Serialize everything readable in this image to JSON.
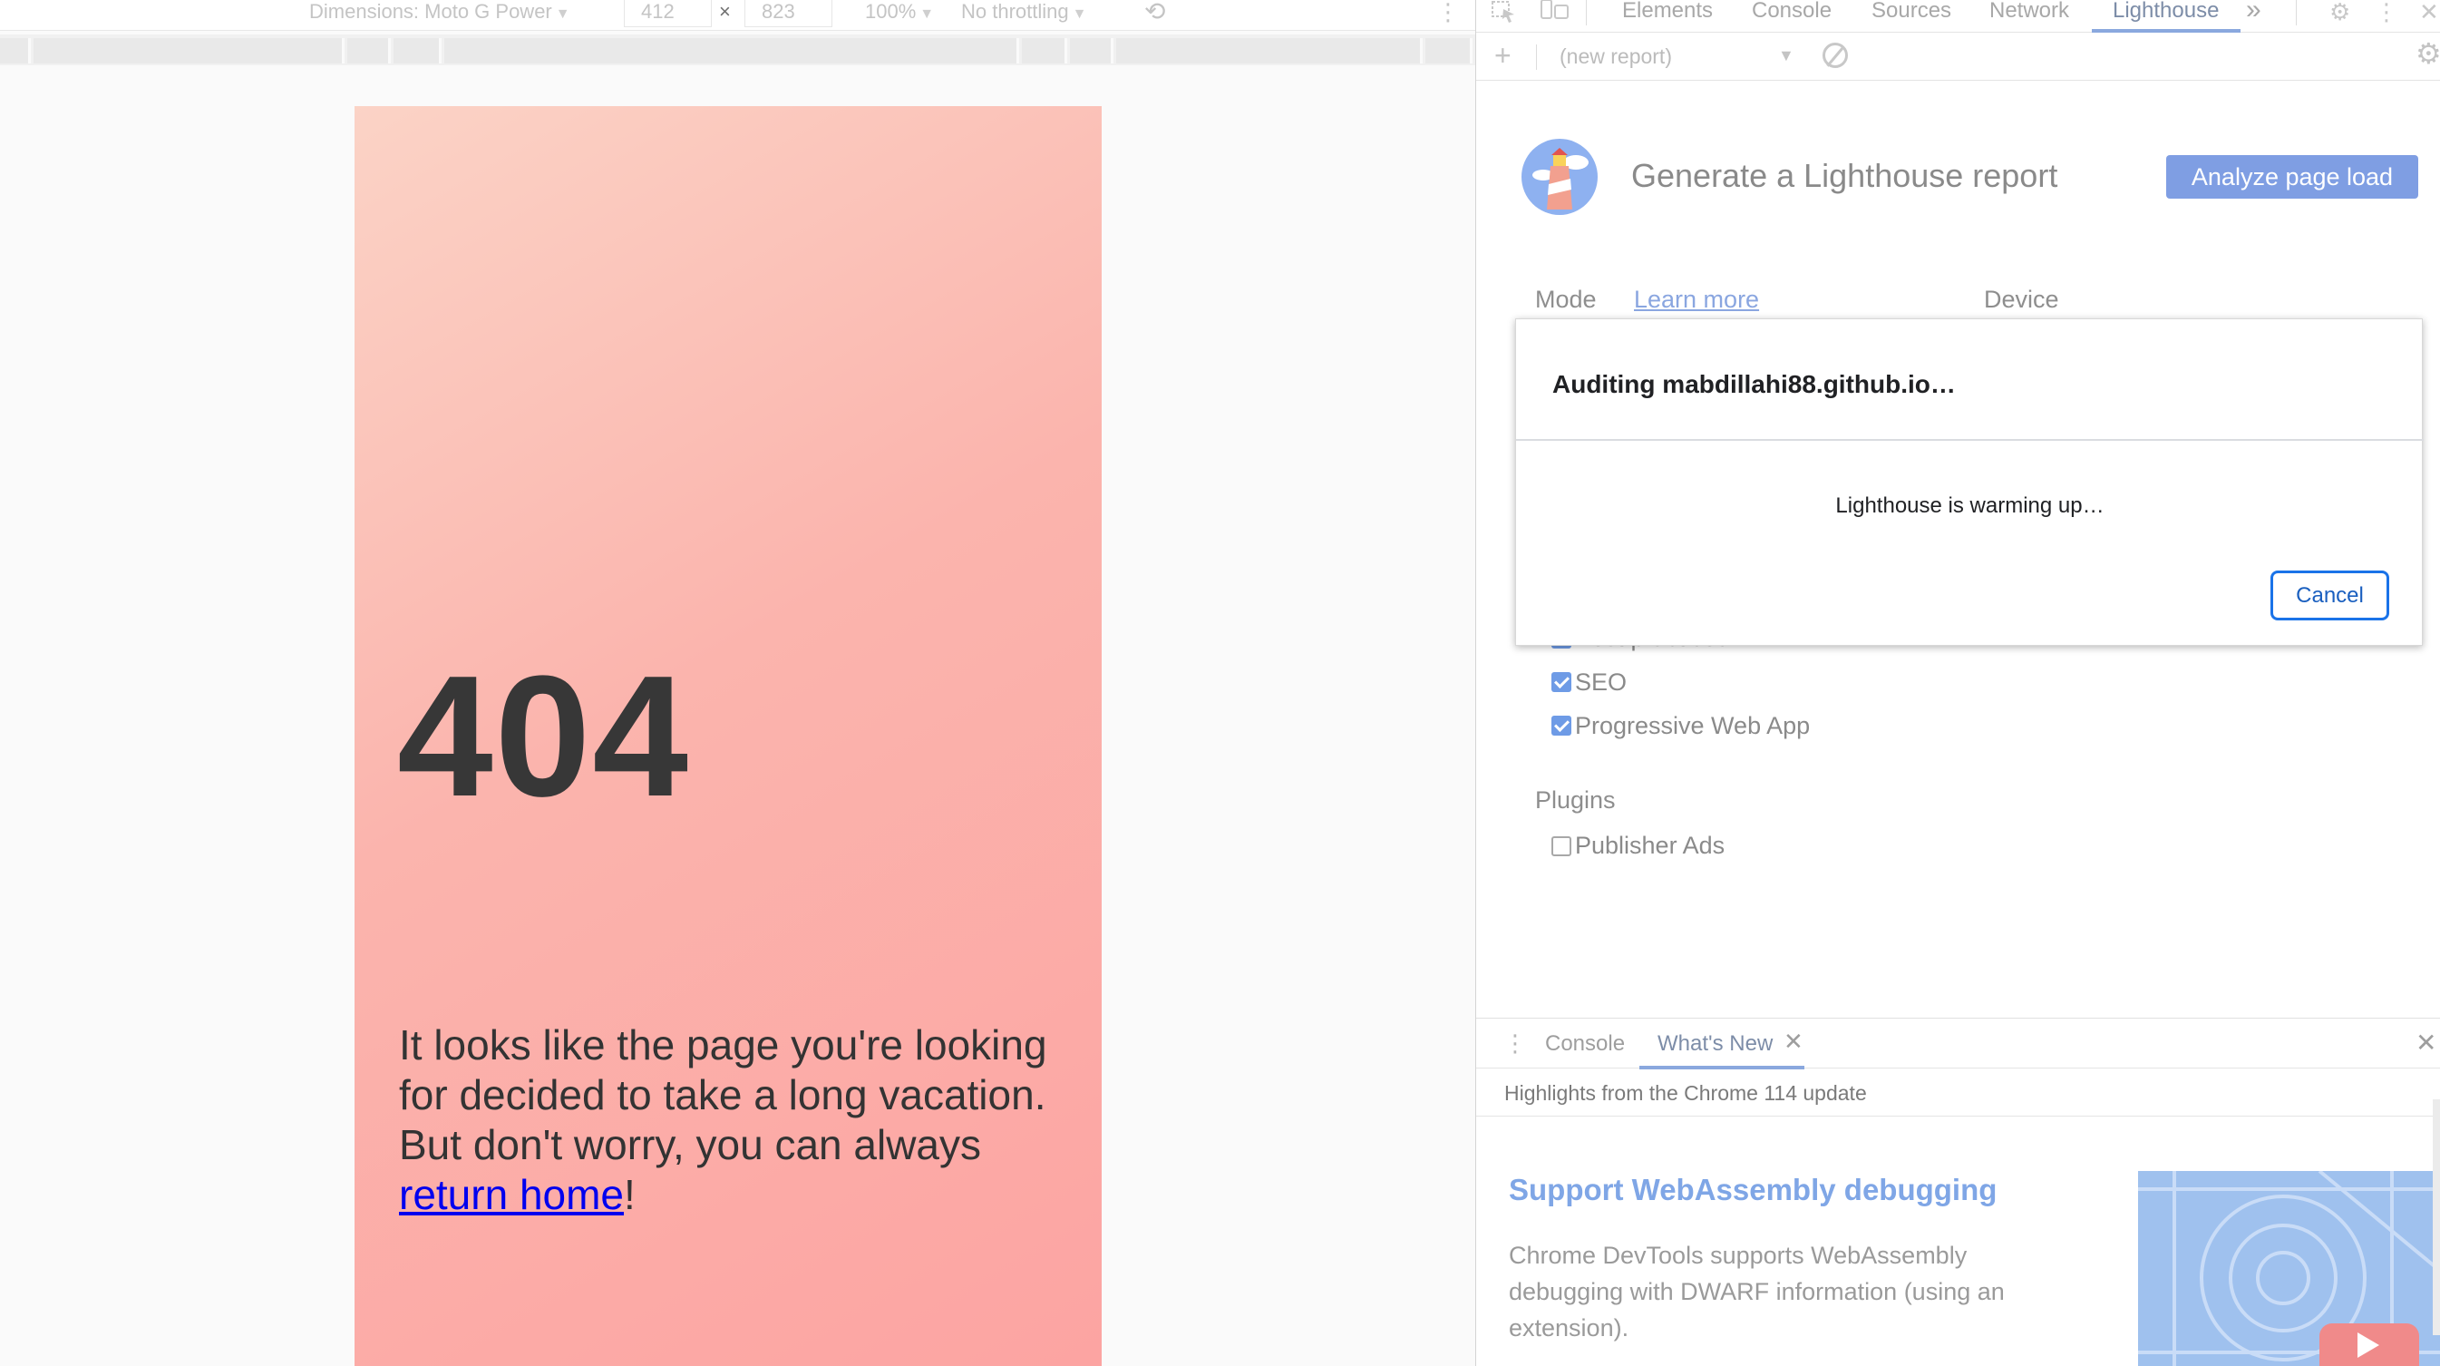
{
  "device_toolbar": {
    "dimensions_label": "Dimensions: Moto G Power",
    "width": "412",
    "times": "×",
    "height": "823",
    "zoom": "100%",
    "throttling": "No throttling"
  },
  "page": {
    "error_code": "404",
    "message_before_link": "It looks like the page you're looking for decided to take a long vacation. But don't worry, you can always ",
    "link_text": "return home",
    "message_after_link": "!"
  },
  "devtools": {
    "tabs": [
      "Elements",
      "Console",
      "Sources",
      "Network",
      "Lighthouse"
    ],
    "active_tab": "Lighthouse",
    "more_tabs": "»",
    "report_select": "(new report)",
    "lighthouse": {
      "title": "Generate a Lighthouse report",
      "analyze_button": "Analyze page load",
      "mode_label": "Mode",
      "learn_more": "Learn more",
      "device_label": "Device",
      "categories": [
        {
          "label": "Best practices",
          "checked": true
        },
        {
          "label": "SEO",
          "checked": true
        },
        {
          "label": "Progressive Web App",
          "checked": true
        }
      ],
      "plugins_label": "Plugins",
      "plugins": [
        {
          "label": "Publisher Ads",
          "checked": false
        }
      ]
    },
    "dialog": {
      "title": "Auditing mabdillahi88.github.io…",
      "status": "Lighthouse is warming up…",
      "cancel": "Cancel"
    },
    "drawer": {
      "tabs": [
        "Console",
        "What's New"
      ],
      "active_tab": "What's New",
      "highlights": "Highlights from the Chrome 114 update",
      "feature_title": "Support WebAssembly debugging",
      "feature_desc": "Chrome DevTools supports WebAssembly debugging with DWARF information (using an extension)."
    }
  },
  "colors": {
    "accent": "#1a73e8",
    "analyze_button": "#7f9ee3",
    "page_gradient_start": "#fbd3c6",
    "page_gradient_end": "#fca4a2"
  }
}
